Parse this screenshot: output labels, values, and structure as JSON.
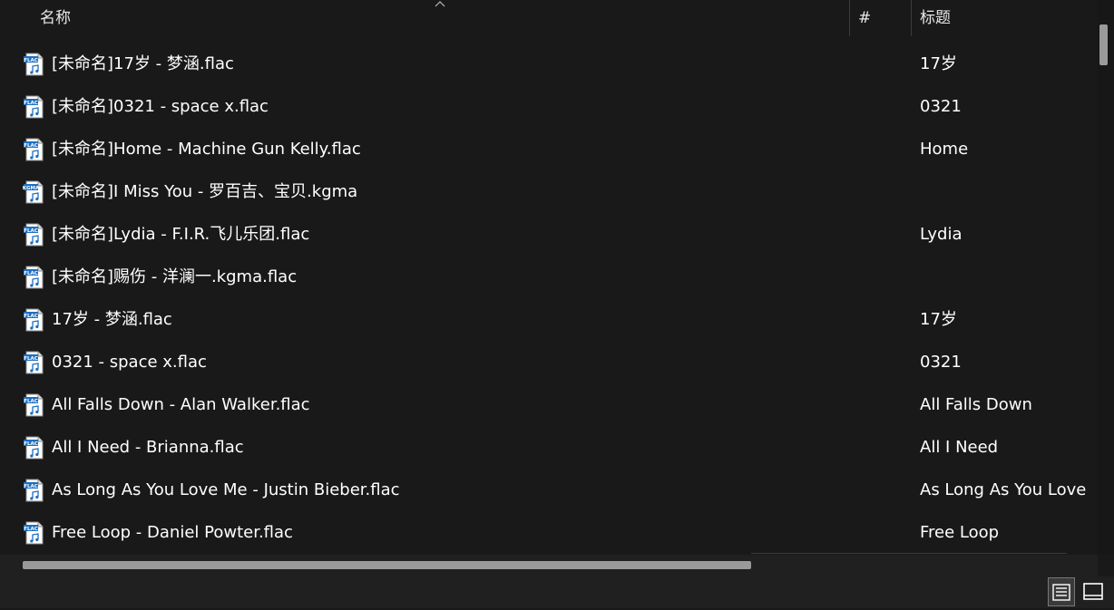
{
  "columns": {
    "name": "名称",
    "number": "#",
    "title": "标题"
  },
  "files": [
    {
      "name": "[未命名]17岁 - 梦涵.flac",
      "title": "17岁",
      "icon": "flac-file-icon",
      "badge": "FLAC"
    },
    {
      "name": "[未命名]0321 - space x.flac",
      "title": "0321",
      "icon": "flac-file-icon",
      "badge": "FLAC"
    },
    {
      "name": "[未命名]Home - Machine Gun Kelly.flac",
      "title": "Home",
      "icon": "flac-file-icon",
      "badge": "FLAC"
    },
    {
      "name": "[未命名]I Miss You - 罗百吉、宝贝.kgma",
      "title": "",
      "icon": "kgma-file-icon",
      "badge": "KGMA"
    },
    {
      "name": "[未命名]Lydia - F.I.R.飞儿乐团.flac",
      "title": "Lydia",
      "icon": "flac-file-icon",
      "badge": "FLAC"
    },
    {
      "name": "[未命名]赐伤 - 洋澜一.kgma.flac",
      "title": "",
      "icon": "flac-file-icon",
      "badge": "FLAC"
    },
    {
      "name": "17岁 - 梦涵.flac",
      "title": "17岁",
      "icon": "flac-file-icon",
      "badge": "FLAC"
    },
    {
      "name": "0321 - space x.flac",
      "title": "0321",
      "icon": "flac-file-icon",
      "badge": "FLAC"
    },
    {
      "name": "All Falls Down - Alan Walker.flac",
      "title": "All Falls Down",
      "icon": "flac-file-icon",
      "badge": "FLAC"
    },
    {
      "name": "All I Need - Brianna.flac",
      "title": "All I Need",
      "icon": "flac-file-icon",
      "badge": "FLAC"
    },
    {
      "name": "As Long As You Love Me - Justin Bieber.flac",
      "title": "As Long As You Love Me",
      "icon": "flac-file-icon",
      "badge": "FLAC"
    },
    {
      "name": "Free Loop - Daniel Powter.flac",
      "title": "Free Loop",
      "icon": "flac-file-icon",
      "badge": "FLAC"
    }
  ],
  "colors": {
    "background": "#191919",
    "text": "#ffffff",
    "scrollbar_thumb": "#9a9a9a",
    "icon_accent": "#1e6fbf"
  },
  "view_modes": [
    "details-view-icon",
    "tiles-view-icon"
  ]
}
